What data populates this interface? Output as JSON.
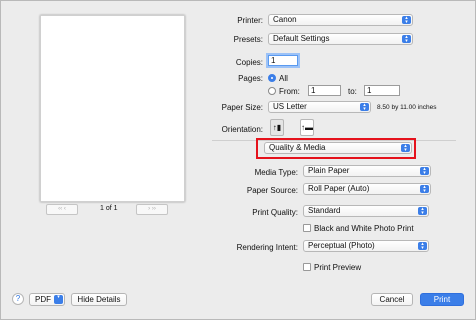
{
  "preview": {
    "page_indicator": "1 of 1",
    "prev_label": "‹‹  ‹",
    "next_label": "›  ››"
  },
  "printer": {
    "label": "Printer:",
    "value": "Canon"
  },
  "presets": {
    "label": "Presets:",
    "value": "Default Settings"
  },
  "copies": {
    "label": "Copies:",
    "value": "1"
  },
  "pages": {
    "label": "Pages:",
    "all_label": "All",
    "from_label": "From:",
    "from_value": "1",
    "to_label": "to:",
    "to_value": "1"
  },
  "paper_size": {
    "label": "Paper Size:",
    "value": "US Letter",
    "dimensions": "8.50 by 11.00 inches"
  },
  "orientation": {
    "label": "Orientation:"
  },
  "section_popup": {
    "value": "Quality & Media"
  },
  "media_type": {
    "label": "Media Type:",
    "value": "Plain Paper"
  },
  "paper_source": {
    "label": "Paper Source:",
    "value": "Roll Paper (Auto)"
  },
  "print_quality": {
    "label": "Print Quality:",
    "value": "Standard"
  },
  "bw_photo": {
    "label": "Black and White Photo Print"
  },
  "rendering_intent": {
    "label": "Rendering Intent:",
    "value": "Perceptual (Photo)"
  },
  "print_preview": {
    "label": "Print Preview"
  },
  "footer": {
    "help": "?",
    "pdf": "PDF",
    "hide_details": "Hide Details",
    "cancel": "Cancel",
    "print": "Print"
  },
  "colors": {
    "accent": "#3b7ee8",
    "highlight": "#e5121c"
  }
}
